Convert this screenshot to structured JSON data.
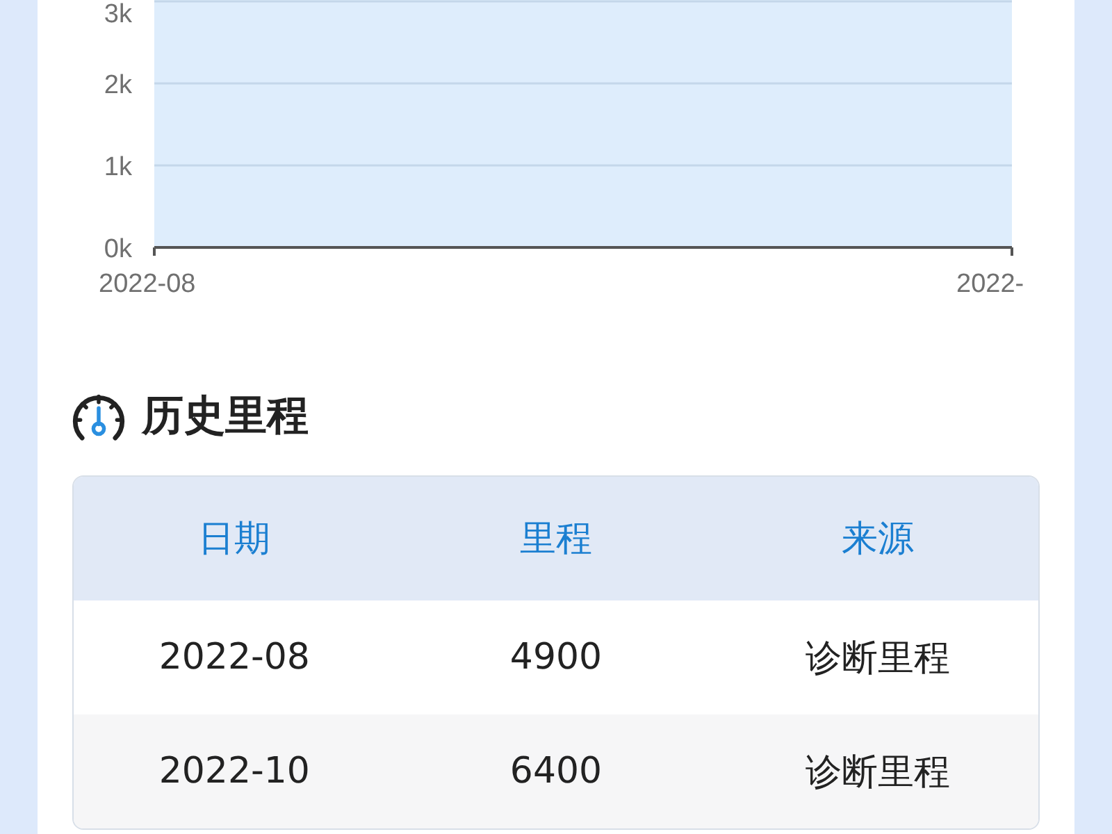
{
  "chart": {
    "y_axis_labels": [
      "3k",
      "2k",
      "1k",
      "0k"
    ],
    "x_axis_labels": [
      "2022-08",
      "2022-"
    ]
  },
  "section": {
    "title": "历史里程"
  },
  "table": {
    "columns": [
      "日期",
      "里程",
      "来源"
    ],
    "rows": [
      [
        "2022-08",
        "4900",
        "诊断里程"
      ],
      [
        "2022-10",
        "6400",
        "诊断里程"
      ]
    ]
  }
}
